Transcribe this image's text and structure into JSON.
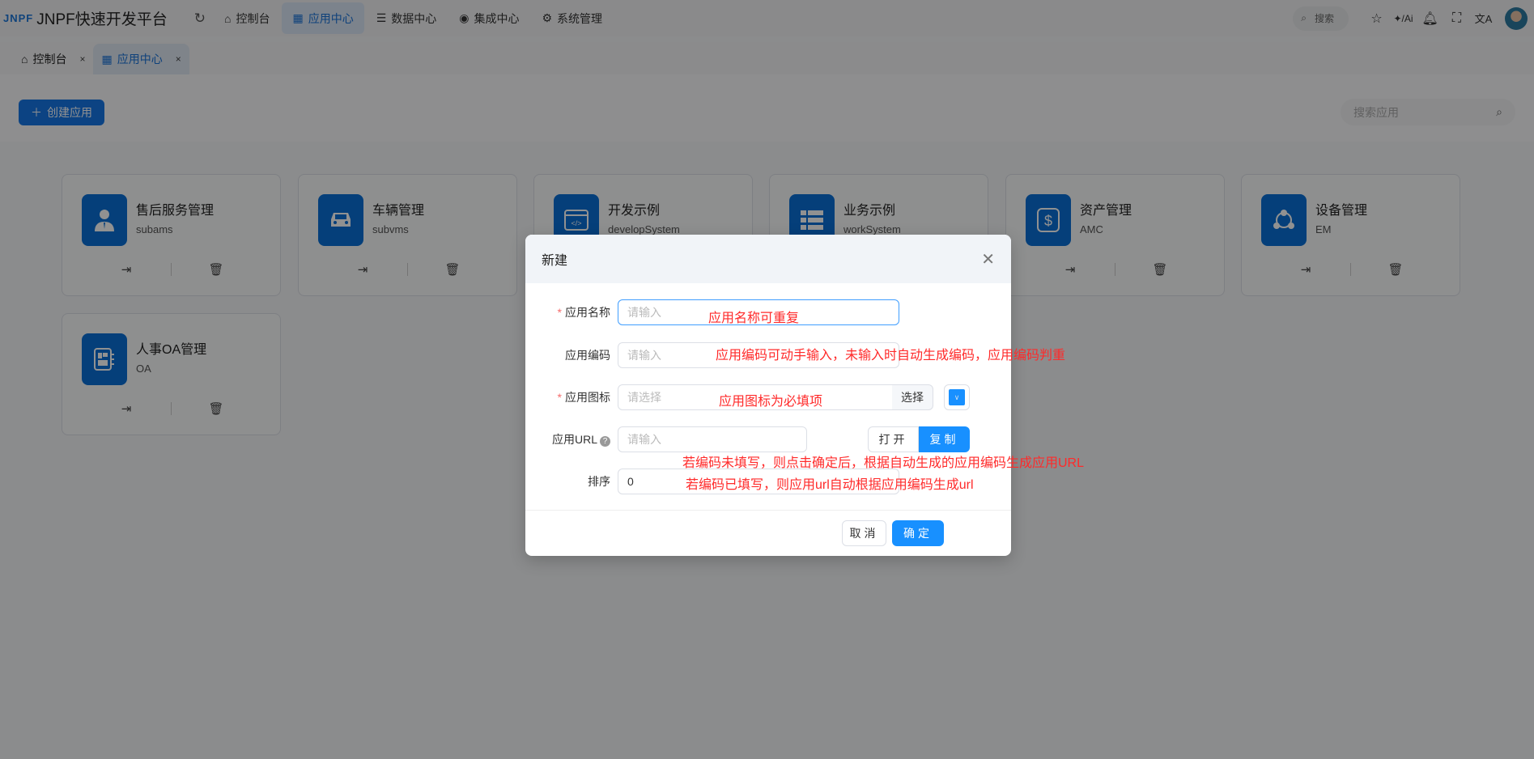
{
  "header": {
    "logo_mark": "JNPF",
    "title": "JNPF快速开发平台",
    "nav": [
      {
        "label": "控制台",
        "icon": "home-icon"
      },
      {
        "label": "应用中心",
        "icon": "grid-icon",
        "active": true
      },
      {
        "label": "数据中心",
        "icon": "database-icon"
      },
      {
        "label": "集成中心",
        "icon": "integration-icon"
      },
      {
        "label": "系统管理",
        "icon": "gear-icon"
      }
    ],
    "search_label": "搜索"
  },
  "tabs": [
    {
      "label": "控制台",
      "icon": "home-icon"
    },
    {
      "label": "应用中心",
      "icon": "grid-icon",
      "active": true
    }
  ],
  "toolbar": {
    "create_label": "创建应用",
    "search_placeholder": "搜索应用"
  },
  "apps": [
    {
      "name": "售后服务管理",
      "code": "subams",
      "icon": "user-icon"
    },
    {
      "name": "车辆管理",
      "code": "subvms",
      "icon": "car-icon"
    },
    {
      "name": "开发示例",
      "code": "developSystem",
      "icon": "code-window-icon"
    },
    {
      "name": "业务示例",
      "code": "workSystem",
      "icon": "list-icon"
    },
    {
      "name": "资产管理",
      "code": "AMC",
      "icon": "dollar-icon"
    },
    {
      "name": "设备管理",
      "code": "EM",
      "icon": "network-icon"
    },
    {
      "name": "人事OA管理",
      "code": "OA",
      "icon": "notebook-icon"
    }
  ],
  "dialog": {
    "title": "新建",
    "fields": {
      "name_label": "应用名称",
      "name_placeholder": "请输入",
      "code_label": "应用编码",
      "code_placeholder": "请输入",
      "icon_label": "应用图标",
      "icon_placeholder": "请选择",
      "icon_select": "选择",
      "url_label": "应用URL",
      "url_placeholder": "请输入",
      "open": "打开",
      "copy": "复制",
      "sort_label": "排序",
      "sort_value": "0"
    },
    "cancel": "取消",
    "confirm": "确定",
    "icon_color": "#1890ff"
  },
  "annotations": {
    "name": "应用名称可重复",
    "code": "应用编码可动手输入，未输入时自动生成编码，应用编码判重",
    "icon": "应用图标为必填项",
    "url1": "若编码未填写，则点击确定后，根据自动生成的应用编码生成应用URL",
    "url2": "若编码已填写，则应用url自动根据应用编码生成url"
  }
}
